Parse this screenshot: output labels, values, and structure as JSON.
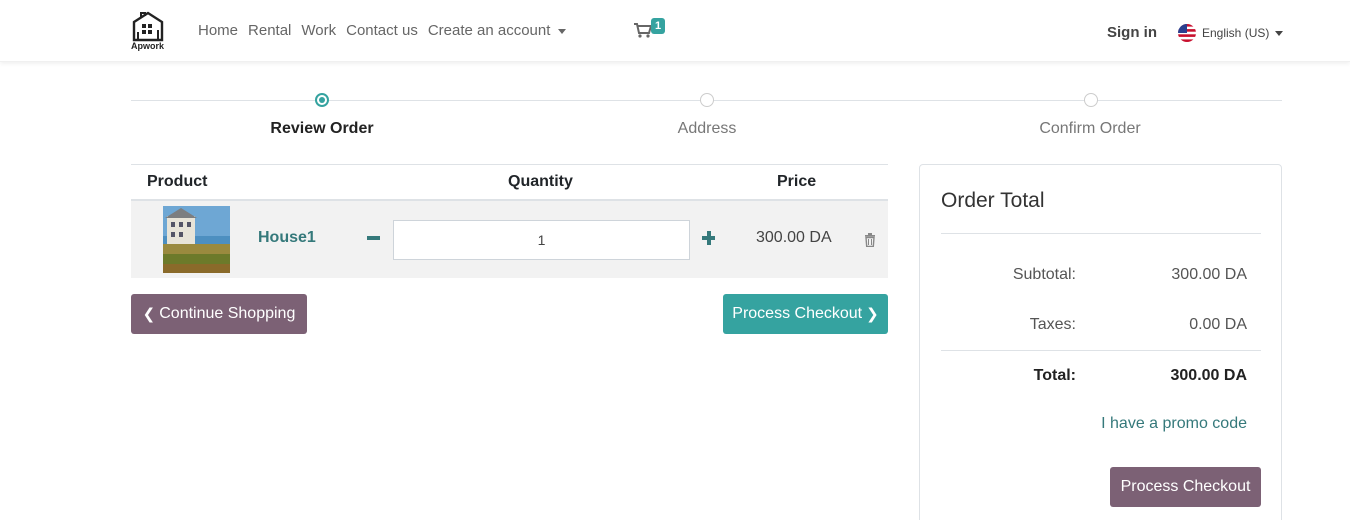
{
  "navbar": {
    "logo_text": "Apwork",
    "links": [
      "Home",
      "Rental",
      "Work",
      "Contact us",
      "Create an account"
    ],
    "cart_count": "1",
    "signin": "Sign in",
    "language": "English (US)"
  },
  "steps": [
    {
      "label": "Review Order",
      "active": true
    },
    {
      "label": "Address",
      "active": false
    },
    {
      "label": "Confirm Order",
      "active": false
    }
  ],
  "table": {
    "headers": {
      "product": "Product",
      "quantity": "Quantity",
      "price": "Price"
    },
    "rows": [
      {
        "product": "House1",
        "quantity": "1",
        "price": "300.00 DA"
      }
    ]
  },
  "buttons": {
    "continue_shopping": "Continue Shopping",
    "process_checkout": "Process Checkout"
  },
  "order_total": {
    "title": "Order Total",
    "subtotal_label": "Subtotal:",
    "subtotal_value": "300.00 DA",
    "taxes_label": "Taxes:",
    "taxes_value": "0.00 DA",
    "total_label": "Total:",
    "total_value": "300.00 DA",
    "promo": "I have a promo code",
    "checkout_button": "Process Checkout"
  },
  "colors": {
    "accent": "#35a3a0",
    "secondary": "#7c6175",
    "link": "#35797b"
  }
}
